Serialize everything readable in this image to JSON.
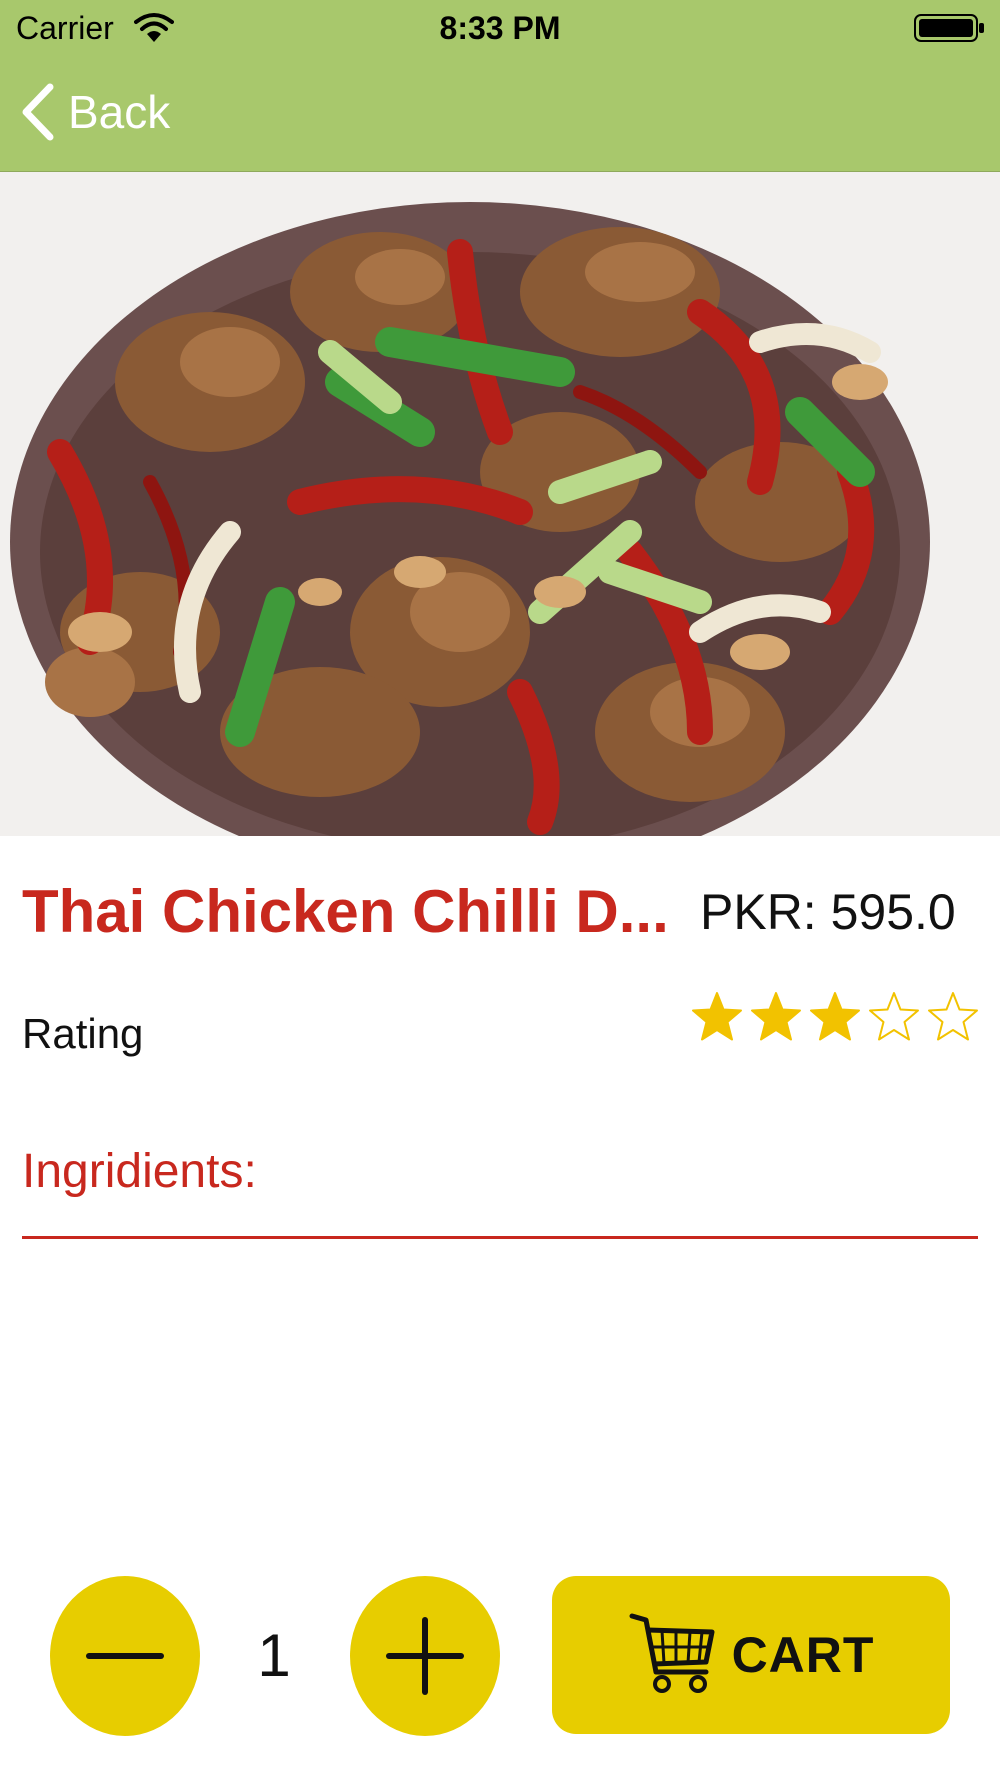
{
  "status_bar": {
    "carrier": "Carrier",
    "time": "8:33 PM"
  },
  "nav": {
    "back_label": "Back",
    "bar_color": "#a8c86c"
  },
  "product": {
    "title": "Thai Chicken Chilli D...",
    "price": "PKR: 595.0",
    "rating_label": "Rating",
    "rating": 3,
    "rating_max": 5,
    "image": "food-photo-stir-fry"
  },
  "ingredients": {
    "label": "Ingridients:"
  },
  "controls": {
    "quantity": "1",
    "cart_label": "CART",
    "button_color": "#e7cd00"
  },
  "colors": {
    "accent_red": "#c8281e",
    "star_gold": "#f2c200"
  },
  "icons": [
    "wifi-icon",
    "battery-icon",
    "chevron-left-icon",
    "star-filled-icon",
    "star-outline-icon",
    "minus-icon",
    "plus-icon",
    "shopping-cart-icon"
  ]
}
